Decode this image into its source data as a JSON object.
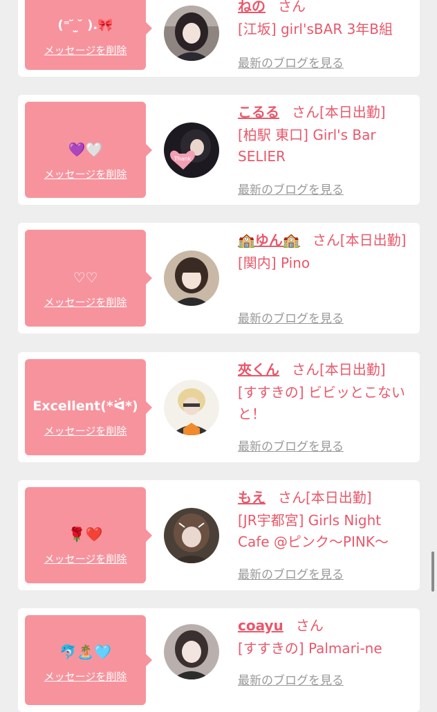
{
  "colors": {
    "accent": "#e8586a",
    "bubble": "#f7939d",
    "link_gray": "#999999",
    "background": "#eeeeee"
  },
  "cards": [
    {
      "message": "(⁼ ̆ ̫ ̆ ).🎀",
      "delete_label": "メッセージを削除",
      "name": "ねの",
      "suffix": "さん",
      "shop": "[江坂] girl'sBAR 3年B組",
      "blog_label": "最新のブログを見る",
      "avatar_icon": "girl-photo-icon"
    },
    {
      "message": "💜🤍",
      "delete_label": "メッセージを削除",
      "name": "こるる",
      "suffix": "さん[本日出勤]",
      "shop": "[柏駅 東口] Girl's Bar SELIER",
      "blog_label": "最新のブログを見る",
      "avatar_icon": "thank-you-heart-photo-icon"
    },
    {
      "message": "♡♡",
      "delete_label": "メッセージを削除",
      "name": "🏫ゆん🏫",
      "suffix": "さん[本日出勤]",
      "shop": "[関内] Pino",
      "blog_label": "最新のブログを見る",
      "avatar_icon": "girl-photo-icon"
    },
    {
      "message": "Excellent(*ᐛ*)",
      "delete_label": "メッセージを削除",
      "name": "夾くん",
      "suffix": "さん[本日出勤]",
      "shop": "[すすきの] ビビッとこないと！",
      "blog_label": "最新のブログを見る",
      "avatar_icon": "blond-boy-photo-icon"
    },
    {
      "message": "🌹❤️",
      "delete_label": "メッセージを削除",
      "name": "もえ",
      "suffix": "さん[本日出勤]",
      "shop": "[JR宇都宮] Girls Night Cafe @ピンク〜PINK〜",
      "blog_label": "最新のブログを見る",
      "avatar_icon": "girl-photo-icon"
    },
    {
      "message": "🐬🏝️🩵",
      "delete_label": "メッセージを削除",
      "name": "coayu",
      "suffix": "さん",
      "shop": "[すすきの] Palmari-ne",
      "blog_label": "最新のブログを見る",
      "avatar_icon": "girl-photo-icon"
    }
  ]
}
